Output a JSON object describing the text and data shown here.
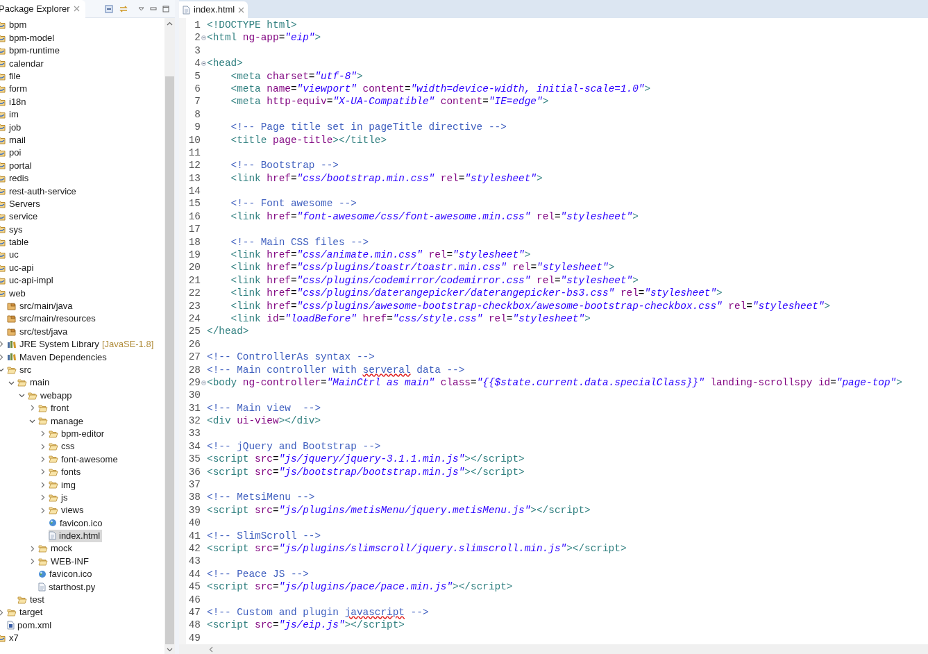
{
  "package_explorer": {
    "title": "Package Explorer",
    "tree": [
      {
        "label": "bpm",
        "kind": "project",
        "selected": false
      },
      {
        "label": "bpm-model",
        "kind": "project",
        "selected": false
      },
      {
        "label": "bpm-runtime",
        "kind": "project",
        "selected": false
      },
      {
        "label": "calendar",
        "kind": "project",
        "selected": false
      },
      {
        "label": "file",
        "kind": "project",
        "selected": false
      },
      {
        "label": "form",
        "kind": "project",
        "selected": false
      },
      {
        "label": "i18n",
        "kind": "project",
        "selected": false
      },
      {
        "label": "im",
        "kind": "project",
        "selected": false
      },
      {
        "label": "job",
        "kind": "project",
        "selected": false
      },
      {
        "label": "mail",
        "kind": "project",
        "selected": false
      },
      {
        "label": "poi",
        "kind": "project",
        "selected": false
      },
      {
        "label": "portal",
        "kind": "project",
        "selected": false
      },
      {
        "label": "redis",
        "kind": "project",
        "selected": false
      },
      {
        "label": "rest-auth-service",
        "kind": "project",
        "selected": false
      },
      {
        "label": "Servers",
        "kind": "project",
        "selected": false
      },
      {
        "label": "service",
        "kind": "project",
        "selected": false
      },
      {
        "label": "sys",
        "kind": "project",
        "selected": false
      },
      {
        "label": "table",
        "kind": "project",
        "selected": false
      },
      {
        "label": "uc",
        "kind": "project",
        "selected": false
      },
      {
        "label": "uc-api",
        "kind": "project",
        "selected": false
      },
      {
        "label": "uc-api-impl",
        "kind": "project",
        "selected": false
      },
      {
        "label": "web",
        "kind": "project",
        "selected": false,
        "children": [
          {
            "label": "src/main/java",
            "kind": "source-folder",
            "selected": false
          },
          {
            "label": "src/main/resources",
            "kind": "source-folder",
            "selected": false
          },
          {
            "label": "src/test/java",
            "kind": "source-folder",
            "selected": false
          },
          {
            "label": "JRE System Library",
            "decoration": "[JavaSE-1.8]",
            "kind": "library",
            "selected": false,
            "expanded": false
          },
          {
            "label": "Maven Dependencies",
            "kind": "library",
            "selected": false,
            "expanded": false
          },
          {
            "label": "src",
            "kind": "folder",
            "selected": false,
            "expanded": true,
            "children": [
              {
                "label": "main",
                "kind": "folder",
                "selected": false,
                "expanded": true,
                "children": [
                  {
                    "label": "webapp",
                    "kind": "folder",
                    "selected": false,
                    "expanded": true,
                    "children": [
                      {
                        "label": "front",
                        "kind": "folder",
                        "selected": false,
                        "expanded": false
                      },
                      {
                        "label": "manage",
                        "kind": "folder",
                        "selected": false,
                        "expanded": true,
                        "children": [
                          {
                            "label": "bpm-editor",
                            "kind": "folder",
                            "selected": false,
                            "expanded": false
                          },
                          {
                            "label": "css",
                            "kind": "folder",
                            "selected": false,
                            "expanded": false
                          },
                          {
                            "label": "font-awesome",
                            "kind": "folder",
                            "selected": false,
                            "expanded": false
                          },
                          {
                            "label": "fonts",
                            "kind": "folder",
                            "selected": false,
                            "expanded": false
                          },
                          {
                            "label": "img",
                            "kind": "folder",
                            "selected": false,
                            "expanded": false
                          },
                          {
                            "label": "js",
                            "kind": "folder",
                            "selected": false,
                            "expanded": false
                          },
                          {
                            "label": "views",
                            "kind": "folder",
                            "selected": false,
                            "expanded": false
                          },
                          {
                            "label": "favicon.ico",
                            "kind": "web-file",
                            "selected": false
                          },
                          {
                            "label": "index.html",
                            "kind": "file",
                            "selected": true
                          }
                        ]
                      },
                      {
                        "label": "mock",
                        "kind": "folder",
                        "selected": false,
                        "expanded": false
                      },
                      {
                        "label": "WEB-INF",
                        "kind": "folder",
                        "selected": false,
                        "expanded": false
                      },
                      {
                        "label": "favicon.ico",
                        "kind": "web-file",
                        "selected": false
                      },
                      {
                        "label": "starthost.py",
                        "kind": "file",
                        "selected": false
                      }
                    ]
                  }
                ]
              },
              {
                "label": "test",
                "kind": "folder",
                "selected": false
              }
            ]
          },
          {
            "label": "target",
            "kind": "folder",
            "selected": false,
            "expanded": false
          },
          {
            "label": "pom.xml",
            "kind": "xml-file",
            "selected": false
          }
        ]
      },
      {
        "label": "x7",
        "kind": "project",
        "selected": false
      }
    ]
  },
  "editor": {
    "tabs": [
      {
        "label": "index.html",
        "selected": true
      }
    ],
    "lines": [
      {
        "number": "1",
        "tokens": [
          {
            "kind": "tag",
            "text": "<!DOCTYPE html>"
          }
        ]
      },
      {
        "number": "2",
        "collapsible": true,
        "tokens": [
          {
            "kind": "tag",
            "text": "<html"
          },
          {
            "kind": "attr",
            "text": " ng-app"
          },
          {
            "kind": "eq",
            "text": "="
          },
          {
            "kind": "value",
            "text": "\"eip\""
          },
          {
            "kind": "tag",
            "text": ">"
          }
        ]
      },
      {
        "number": "3"
      },
      {
        "number": "4",
        "collapsible": true,
        "tokens": [
          {
            "kind": "tag",
            "text": "<head>"
          }
        ]
      },
      {
        "number": "5",
        "tokens": [
          {
            "kind": "tag",
            "text": "    <meta"
          },
          {
            "kind": "attr",
            "text": " charset"
          },
          {
            "kind": "eq",
            "text": "="
          },
          {
            "kind": "value",
            "text": "\"utf-8\""
          },
          {
            "kind": "tag",
            "text": ">"
          }
        ]
      },
      {
        "number": "6",
        "tokens": [
          {
            "kind": "tag",
            "text": "    <meta"
          },
          {
            "kind": "attr",
            "text": " name"
          },
          {
            "kind": "eq",
            "text": "="
          },
          {
            "kind": "value",
            "text": "\"viewport\""
          },
          {
            "kind": "attr",
            "text": " content"
          },
          {
            "kind": "eq",
            "text": "="
          },
          {
            "kind": "value",
            "text": "\"width=device-width, initial-scale=1.0\""
          },
          {
            "kind": "tag",
            "text": ">"
          }
        ]
      },
      {
        "number": "7",
        "tokens": [
          {
            "kind": "tag",
            "text": "    <meta"
          },
          {
            "kind": "attr",
            "text": " http-equiv"
          },
          {
            "kind": "eq",
            "text": "="
          },
          {
            "kind": "value",
            "text": "\"X-UA-Compatible\""
          },
          {
            "kind": "attr",
            "text": " content"
          },
          {
            "kind": "eq",
            "text": "="
          },
          {
            "kind": "value",
            "text": "\"IE=edge\""
          },
          {
            "kind": "tag",
            "text": ">"
          }
        ]
      },
      {
        "number": "8"
      },
      {
        "number": "9",
        "tokens": [
          {
            "kind": "comment",
            "text": "    <!-- Page title set in pageTitle directive -->"
          }
        ]
      },
      {
        "number": "10",
        "tokens": [
          {
            "kind": "tag",
            "text": "    <title"
          },
          {
            "kind": "attr",
            "text": " page-title"
          },
          {
            "kind": "tag",
            "text": "></title>"
          }
        ]
      },
      {
        "number": "11"
      },
      {
        "number": "12",
        "tokens": [
          {
            "kind": "comment",
            "text": "    <!-- Bootstrap -->"
          }
        ]
      },
      {
        "number": "13",
        "tokens": [
          {
            "kind": "tag",
            "text": "    <link"
          },
          {
            "kind": "attr",
            "text": " href"
          },
          {
            "kind": "eq",
            "text": "="
          },
          {
            "kind": "value",
            "text": "\"css/bootstrap.min.css\""
          },
          {
            "kind": "attr",
            "text": " rel"
          },
          {
            "kind": "eq",
            "text": "="
          },
          {
            "kind": "value",
            "text": "\"stylesheet\""
          },
          {
            "kind": "tag",
            "text": ">"
          }
        ]
      },
      {
        "number": "14"
      },
      {
        "number": "15",
        "tokens": [
          {
            "kind": "comment",
            "text": "    <!-- Font awesome -->"
          }
        ]
      },
      {
        "number": "16",
        "tokens": [
          {
            "kind": "tag",
            "text": "    <link"
          },
          {
            "kind": "attr",
            "text": " href"
          },
          {
            "kind": "eq",
            "text": "="
          },
          {
            "kind": "value",
            "text": "\"font-awesome/css/font-awesome.min.css\""
          },
          {
            "kind": "attr",
            "text": " rel"
          },
          {
            "kind": "eq",
            "text": "="
          },
          {
            "kind": "value",
            "text": "\"stylesheet\""
          },
          {
            "kind": "tag",
            "text": ">"
          }
        ]
      },
      {
        "number": "17"
      },
      {
        "number": "18",
        "tokens": [
          {
            "kind": "comment",
            "text": "    <!-- Main CSS files -->"
          }
        ]
      },
      {
        "number": "19",
        "tokens": [
          {
            "kind": "tag",
            "text": "    <link"
          },
          {
            "kind": "attr",
            "text": " href"
          },
          {
            "kind": "eq",
            "text": "="
          },
          {
            "kind": "value",
            "text": "\"css/animate.min.css\""
          },
          {
            "kind": "attr",
            "text": " rel"
          },
          {
            "kind": "eq",
            "text": "="
          },
          {
            "kind": "value",
            "text": "\"stylesheet\""
          },
          {
            "kind": "tag",
            "text": ">"
          }
        ]
      },
      {
        "number": "20",
        "tokens": [
          {
            "kind": "tag",
            "text": "    <link"
          },
          {
            "kind": "attr",
            "text": " href"
          },
          {
            "kind": "eq",
            "text": "="
          },
          {
            "kind": "value",
            "text": "\"css/plugins/toastr/toastr.min.css\""
          },
          {
            "kind": "attr",
            "text": " rel"
          },
          {
            "kind": "eq",
            "text": "="
          },
          {
            "kind": "value",
            "text": "\"stylesheet\""
          },
          {
            "kind": "tag",
            "text": ">"
          }
        ]
      },
      {
        "number": "21",
        "tokens": [
          {
            "kind": "tag",
            "text": "    <link"
          },
          {
            "kind": "attr",
            "text": " href"
          },
          {
            "kind": "eq",
            "text": "="
          },
          {
            "kind": "value",
            "text": "\"css/plugins/codemirror/codemirror.css\""
          },
          {
            "kind": "attr",
            "text": " rel"
          },
          {
            "kind": "eq",
            "text": "="
          },
          {
            "kind": "value",
            "text": "\"stylesheet\""
          },
          {
            "kind": "tag",
            "text": ">"
          }
        ]
      },
      {
        "number": "22",
        "tokens": [
          {
            "kind": "tag",
            "text": "    <link"
          },
          {
            "kind": "attr",
            "text": " href"
          },
          {
            "kind": "eq",
            "text": "="
          },
          {
            "kind": "value",
            "text": "\"css/plugins/daterangepicker/daterangepicker-bs3.css\""
          },
          {
            "kind": "attr",
            "text": " rel"
          },
          {
            "kind": "eq",
            "text": "="
          },
          {
            "kind": "value",
            "text": "\"stylesheet\""
          },
          {
            "kind": "tag",
            "text": ">"
          }
        ]
      },
      {
        "number": "23",
        "tokens": [
          {
            "kind": "tag",
            "text": "    <link"
          },
          {
            "kind": "attr",
            "text": " href"
          },
          {
            "kind": "eq",
            "text": "="
          },
          {
            "kind": "value",
            "text": "\"css/plugins/awesome-bootstrap-checkbox/awesome-bootstrap-checkbox.css\""
          },
          {
            "kind": "attr",
            "text": " rel"
          },
          {
            "kind": "eq",
            "text": "="
          },
          {
            "kind": "value",
            "text": "\"stylesheet\""
          },
          {
            "kind": "tag",
            "text": ">"
          }
        ]
      },
      {
        "number": "24",
        "tokens": [
          {
            "kind": "tag",
            "text": "    <link"
          },
          {
            "kind": "attr",
            "text": " id"
          },
          {
            "kind": "eq",
            "text": "="
          },
          {
            "kind": "value",
            "text": "\"loadBefore\""
          },
          {
            "kind": "attr",
            "text": " href"
          },
          {
            "kind": "eq",
            "text": "="
          },
          {
            "kind": "value",
            "text": "\"css/style.css\""
          },
          {
            "kind": "attr",
            "text": " rel"
          },
          {
            "kind": "eq",
            "text": "="
          },
          {
            "kind": "value",
            "text": "\"stylesheet\""
          },
          {
            "kind": "tag",
            "text": ">"
          }
        ]
      },
      {
        "number": "25",
        "tokens": [
          {
            "kind": "tag",
            "text": "</head>"
          }
        ]
      },
      {
        "number": "26"
      },
      {
        "number": "27",
        "tokens": [
          {
            "kind": "comment",
            "text": "<!-- ControllerAs syntax -->"
          }
        ]
      },
      {
        "number": "28",
        "tokens": [
          {
            "kind": "comment",
            "text": "<!-- Main controller with "
          },
          {
            "kind": "comment",
            "text": "serveral",
            "misspelled": true
          },
          {
            "kind": "comment",
            "text": " data -->"
          }
        ]
      },
      {
        "number": "29",
        "collapsible": true,
        "tokens": [
          {
            "kind": "tag",
            "text": "<body"
          },
          {
            "kind": "attr",
            "text": " ng-controller"
          },
          {
            "kind": "eq",
            "text": "="
          },
          {
            "kind": "value",
            "text": "\"MainCtrl as main\""
          },
          {
            "kind": "attr",
            "text": " class"
          },
          {
            "kind": "eq",
            "text": "="
          },
          {
            "kind": "value",
            "text": "\"{{$state.current.data.specialClass}}\""
          },
          {
            "kind": "attr",
            "text": " landing-scrollspy id"
          },
          {
            "kind": "eq",
            "text": "="
          },
          {
            "kind": "value",
            "text": "\"page-top\""
          },
          {
            "kind": "tag",
            "text": ">"
          }
        ]
      },
      {
        "number": "30"
      },
      {
        "number": "31",
        "tokens": [
          {
            "kind": "comment",
            "text": "<!-- Main view  -->"
          }
        ]
      },
      {
        "number": "32",
        "tokens": [
          {
            "kind": "tag",
            "text": "<div"
          },
          {
            "kind": "attr",
            "text": " ui-view"
          },
          {
            "kind": "tag",
            "text": "></div>"
          }
        ]
      },
      {
        "number": "33"
      },
      {
        "number": "34",
        "tokens": [
          {
            "kind": "comment",
            "text": "<!-- jQuery and Bootstrap -->"
          }
        ]
      },
      {
        "number": "35",
        "tokens": [
          {
            "kind": "tag",
            "text": "<script"
          },
          {
            "kind": "attr",
            "text": " src"
          },
          {
            "kind": "eq",
            "text": "="
          },
          {
            "kind": "value",
            "text": "\"js/jquery/jquery-3.1.1.min.js\""
          },
          {
            "kind": "tag",
            "text": "></script>"
          }
        ]
      },
      {
        "number": "36",
        "tokens": [
          {
            "kind": "tag",
            "text": "<script"
          },
          {
            "kind": "attr",
            "text": " src"
          },
          {
            "kind": "eq",
            "text": "="
          },
          {
            "kind": "value",
            "text": "\"js/bootstrap/bootstrap.min.js\""
          },
          {
            "kind": "tag",
            "text": "></script>"
          }
        ]
      },
      {
        "number": "37"
      },
      {
        "number": "38",
        "tokens": [
          {
            "kind": "comment",
            "text": "<!-- MetsiMenu -->"
          }
        ]
      },
      {
        "number": "39",
        "tokens": [
          {
            "kind": "tag",
            "text": "<script"
          },
          {
            "kind": "attr",
            "text": " src"
          },
          {
            "kind": "eq",
            "text": "="
          },
          {
            "kind": "value",
            "text": "\"js/plugins/metisMenu/jquery.metisMenu.js\""
          },
          {
            "kind": "tag",
            "text": "></script>"
          }
        ]
      },
      {
        "number": "40"
      },
      {
        "number": "41",
        "tokens": [
          {
            "kind": "comment",
            "text": "<!-- SlimScroll -->"
          }
        ]
      },
      {
        "number": "42",
        "tokens": [
          {
            "kind": "tag",
            "text": "<script"
          },
          {
            "kind": "attr",
            "text": " src"
          },
          {
            "kind": "eq",
            "text": "="
          },
          {
            "kind": "value",
            "text": "\"js/plugins/slimscroll/jquery.slimscroll.min.js\""
          },
          {
            "kind": "tag",
            "text": "></script>"
          }
        ]
      },
      {
        "number": "43"
      },
      {
        "number": "44",
        "tokens": [
          {
            "kind": "comment",
            "text": "<!-- Peace JS -->"
          }
        ]
      },
      {
        "number": "45",
        "tokens": [
          {
            "kind": "tag",
            "text": "<script"
          },
          {
            "kind": "attr",
            "text": " src"
          },
          {
            "kind": "eq",
            "text": "="
          },
          {
            "kind": "value",
            "text": "\"js/plugins/pace/pace.min.js\""
          },
          {
            "kind": "tag",
            "text": "></script>"
          }
        ]
      },
      {
        "number": "46"
      },
      {
        "number": "47",
        "tokens": [
          {
            "kind": "comment",
            "text": "<!-- Custom and plugin "
          },
          {
            "kind": "comment",
            "text": "javascript",
            "misspelled": true
          },
          {
            "kind": "comment",
            "text": " -->"
          }
        ]
      },
      {
        "number": "48",
        "tokens": [
          {
            "kind": "tag",
            "text": "<script"
          },
          {
            "kind": "attr",
            "text": " src"
          },
          {
            "kind": "eq",
            "text": "="
          },
          {
            "kind": "value",
            "text": "\"js/eip.js\""
          },
          {
            "kind": "tag",
            "text": "></script>"
          }
        ]
      },
      {
        "number": "49"
      }
    ]
  }
}
